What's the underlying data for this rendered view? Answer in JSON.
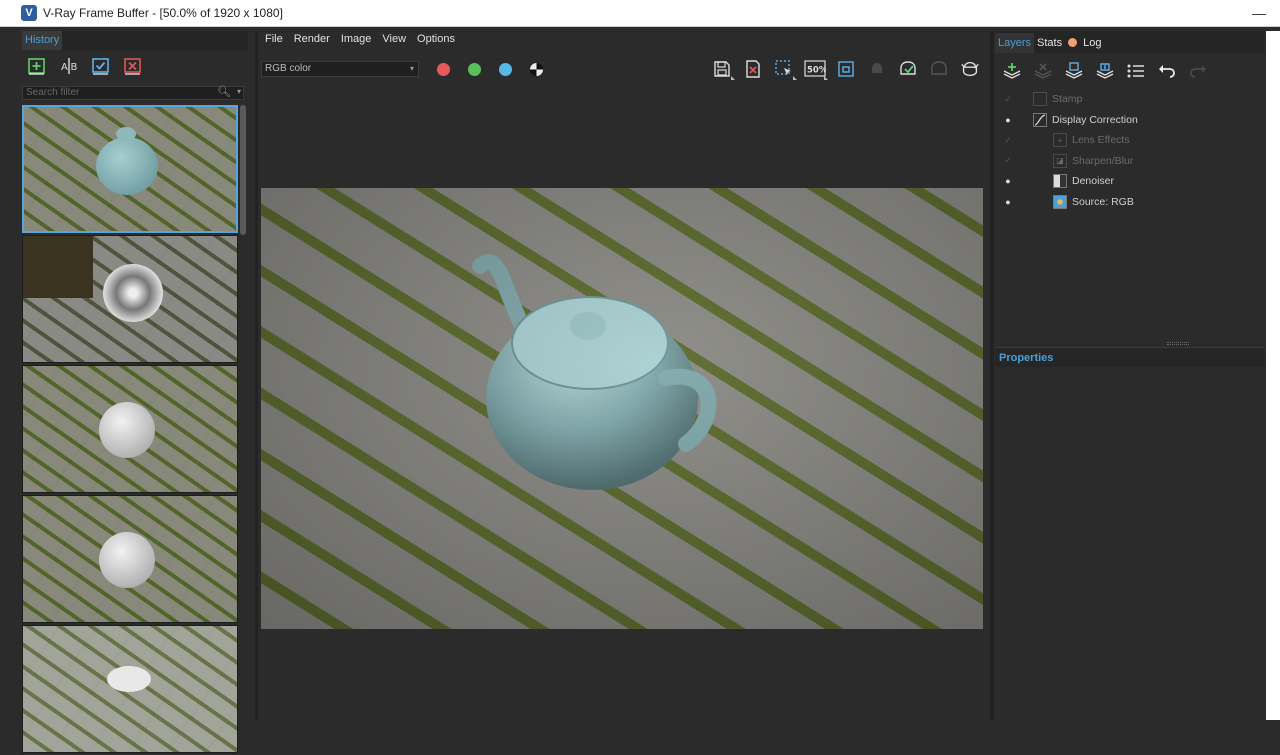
{
  "window": {
    "title": "V-Ray Frame Buffer - [50.0% of 1920 x 1080]",
    "icon": "vray-icon"
  },
  "history": {
    "tab_label": "History",
    "toolbar": [
      "add-to-history-icon",
      "ab-compare-icon",
      "load-check-icon",
      "clear-history-icon"
    ],
    "search_placeholder": "Search filter",
    "thumbnails": [
      {
        "state": "final render, blue teapot",
        "selected": true
      },
      {
        "state": "partial render with noise"
      },
      {
        "state": "white teapot"
      },
      {
        "state": "white teapot"
      },
      {
        "state": "grassy preview"
      }
    ]
  },
  "menu": {
    "file": "File",
    "render": "Render",
    "image": "Image",
    "view": "View",
    "options": "Options"
  },
  "channel": {
    "selected": "RGB color"
  },
  "colors": {
    "accent": "#4a9fd8",
    "red": "#e85a5a",
    "green": "#58c25a",
    "blue": "#58b8ec"
  },
  "toolbar_right": [
    "save-icon",
    "clear-image-icon",
    "region-render-icon",
    "zoom-50-icon",
    "follow-mouse-icon",
    "lock-icon",
    "render-icon",
    "ipr-icon",
    "teapot-render-icon"
  ],
  "toolbar_zoom_label": "50%",
  "layers_panel": {
    "tabs": {
      "layers": "Layers",
      "stats": "Stats",
      "log": "Log"
    },
    "items": [
      {
        "label": "Stamp",
        "enabled": false,
        "icon": "stamp-icon"
      },
      {
        "label": "Display Correction",
        "enabled": true,
        "icon": "curve-icon"
      },
      {
        "label": "Lens Effects",
        "enabled": false,
        "icon": "lens-icon"
      },
      {
        "label": "Sharpen/Blur",
        "enabled": false,
        "icon": "sharpen-icon"
      },
      {
        "label": "Denoiser",
        "enabled": true,
        "icon": "denoiser-icon"
      },
      {
        "label": "Source: RGB",
        "enabled": true,
        "icon": "source-icon"
      }
    ],
    "properties_label": "Properties"
  }
}
